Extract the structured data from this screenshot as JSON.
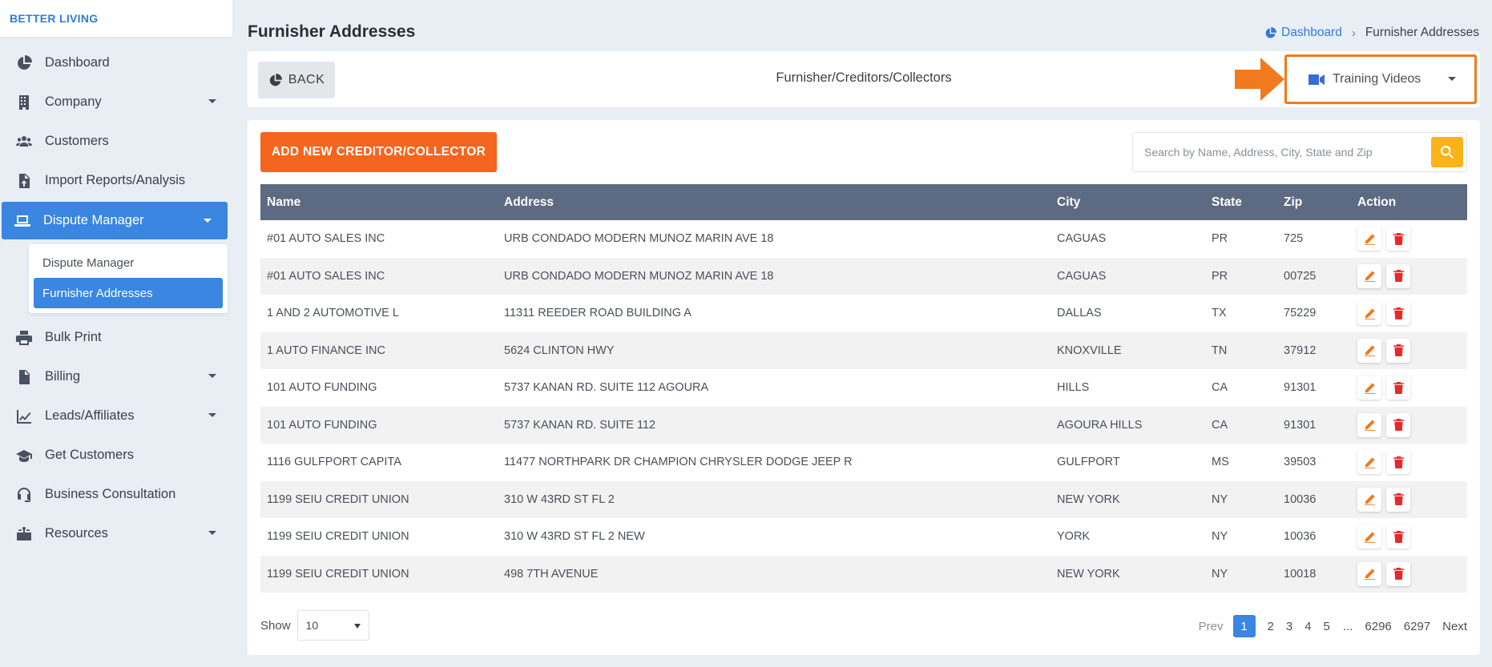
{
  "brand": "BETTER LIVING",
  "sidebar": {
    "items": [
      {
        "label": "Dashboard"
      },
      {
        "label": "Company"
      },
      {
        "label": "Customers"
      },
      {
        "label": "Import Reports/Analysis"
      },
      {
        "label": "Dispute Manager"
      },
      {
        "label": "Bulk Print"
      },
      {
        "label": "Billing"
      },
      {
        "label": "Leads/Affiliates"
      },
      {
        "label": "Get Customers"
      },
      {
        "label": "Business Consultation"
      },
      {
        "label": "Resources"
      }
    ],
    "submenu": [
      {
        "label": "Dispute Manager"
      },
      {
        "label": "Furnisher Addresses"
      }
    ]
  },
  "page": {
    "title": "Furnisher Addresses",
    "breadcrumb": {
      "home": "Dashboard",
      "current": "Furnisher Addresses"
    }
  },
  "toolbar": {
    "back_label": "BACK",
    "title": "Furnisher/Creditors/Collectors",
    "training_label": "Training Videos"
  },
  "actions": {
    "add_label": "ADD NEW CREDITOR/COLLECTOR",
    "search_placeholder": "Search by Name, Address, City, State and Zip"
  },
  "table": {
    "headers": [
      "Name",
      "Address",
      "City",
      "State",
      "Zip",
      "Action"
    ],
    "rows": [
      [
        "#01 AUTO SALES INC",
        "URB CONDADO MODERN MUNOZ MARIN AVE 18",
        "CAGUAS",
        "PR",
        "725"
      ],
      [
        "#01 AUTO SALES INC",
        "URB CONDADO MODERN MUNOZ MARIN AVE 18",
        "CAGUAS",
        "PR",
        "00725"
      ],
      [
        "1 AND 2 AUTOMOTIVE L",
        "11311 REEDER ROAD BUILDING A",
        "DALLAS",
        "TX",
        "75229"
      ],
      [
        "1 AUTO FINANCE INC",
        "5624 CLINTON HWY",
        "KNOXVILLE",
        "TN",
        "37912"
      ],
      [
        "101 AUTO FUNDING",
        "5737 KANAN RD. SUITE 112 AGOURA",
        "HILLS",
        "CA",
        "91301"
      ],
      [
        "101 AUTO FUNDING",
        "5737 KANAN RD. SUITE 112",
        "AGOURA HILLS",
        "CA",
        "91301"
      ],
      [
        "1116 GULFPORT CAPITA",
        "11477 NORTHPARK DR CHAMPION CHRYSLER DODGE JEEP R",
        "GULFPORT",
        "MS",
        "39503"
      ],
      [
        "1199 SEIU CREDIT UNION",
        "310 W 43RD ST FL 2",
        "NEW YORK",
        "NY",
        "10036"
      ],
      [
        "1199 SEIU CREDIT UNION",
        "310 W 43RD ST FL 2 NEW",
        "YORK",
        "NY",
        "10036"
      ],
      [
        "1199 SEIU CREDIT UNION",
        "498 7TH AVENUE",
        "NEW YORK",
        "NY",
        "10018"
      ]
    ]
  },
  "footer": {
    "show_label": "Show",
    "show_value": "10",
    "pagination": {
      "prev": "Prev",
      "pages": [
        "1",
        "2",
        "3",
        "4",
        "5",
        "...",
        "6296",
        "6297"
      ],
      "current": "1",
      "next": "Next"
    }
  },
  "colors": {
    "accent": "#3a86e0",
    "add_button": "#f5651e",
    "search_button": "#fbb31b",
    "table_header": "#5d6b82",
    "highlight": "#f07a1d"
  }
}
